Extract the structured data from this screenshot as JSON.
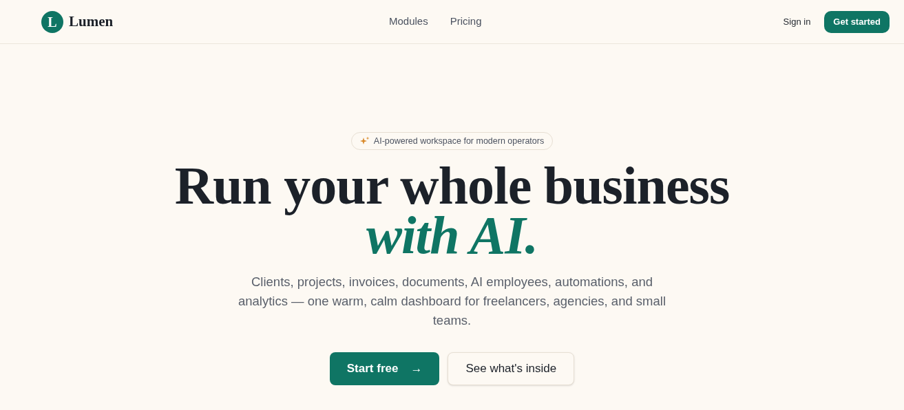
{
  "nav": {
    "logo_mark": "L",
    "brand": "Lumen",
    "links": [
      "Modules",
      "Pricing"
    ],
    "sign_in": "Sign in",
    "cta": "Get started"
  },
  "hero": {
    "badge": "AI-powered workspace for modern operators",
    "headline": "Run your whole business",
    "headline_accent": "with AI.",
    "subtitle": "Clients, projects, invoices, documents, AI employees, automations, and analytics — one warm, calm dashboard for freelancers, agencies, and small teams.",
    "primary_button": "Start free",
    "primary_button_arrow": "→",
    "secondary_button": "See what's inside"
  }
}
